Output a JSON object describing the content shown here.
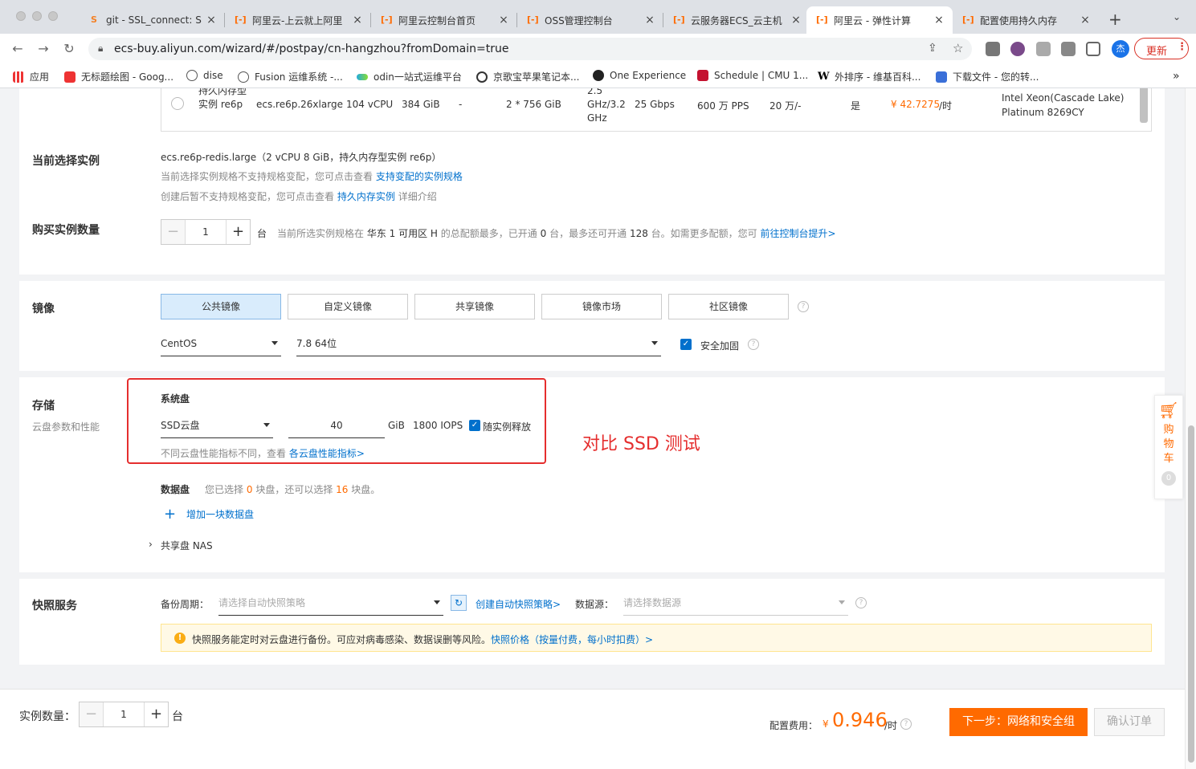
{
  "browser": {
    "tabs": [
      {
        "icon": "stackoverflow-icon",
        "title": "git - SSL_connect: S"
      },
      {
        "icon": "aliyun-icon",
        "title": "阿里云-上云就上阿里"
      },
      {
        "icon": "aliyun-icon",
        "title": "阿里云控制台首页"
      },
      {
        "icon": "aliyun-icon",
        "title": "OSS管理控制台"
      },
      {
        "icon": "aliyun-icon",
        "title": "云服务器ECS_云主机"
      },
      {
        "icon": "aliyun-icon",
        "title": "阿里云 - 弹性计算"
      },
      {
        "icon": "aliyun-icon",
        "title": "配置使用持久内存"
      }
    ],
    "active_tab": 5,
    "url": "ecs-buy.aliyun.com/wizard/#/postpay/cn-hangzhou?fromDomain=true",
    "update_label": "更新",
    "profile_initial": "杰",
    "bookmarks": [
      "应用",
      "无标题绘图 - Goog...",
      "dise",
      "Fusion 运维系统 -...",
      "odin一站式运维平台",
      "京歌宝苹果笔记本...",
      "One Experience",
      "Schedule | CMU 1...",
      "外排序 - 维基百科...",
      "下载文件 - 您的转..."
    ],
    "bookmarks_more": "»"
  },
  "instance_table_row": {
    "family": "持久内存型实例 re6p",
    "spec": "ecs.re6p.26xlarge",
    "vcpu": "104 vCPU",
    "memory": "384 GiB",
    "gpu": "-",
    "pmem": "2 * 756 GiB",
    "clock": "2.5 GHz/3.2 GHz",
    "bandwidth": "25 Gbps",
    "pps": "600 万 PPS",
    "conn": "20 万/-",
    "ipv6": "是",
    "price": "¥ 42.7275",
    "price_unit": "/时",
    "cpu_model": "Intel Xeon(Cascade Lake) Platinum 8269CY"
  },
  "current_instance": {
    "label": "当前选择实例",
    "spec": "ecs.re6p-redis.large",
    "desc": "（2 vCPU 8 GiB，持久内存型实例 re6p）",
    "line2": "当前选择实例规格不支持规格变配，您可点击查看",
    "line2_link": "支持变配的实例规格",
    "line3": "创建后暂不支持规格变配，您可点击查看",
    "line3_link": "持久内存实例",
    "line3_suffix": "详细介绍"
  },
  "quantity": {
    "label": "购买实例数量",
    "value": "1",
    "unit": "台",
    "note_prefix": "当前所选实例规格在",
    "zone": "华东 1 可用区 H",
    "note_mid": "的总配额最多，已开通",
    "opened": "0",
    "note_mid2": "台，最多还可开通",
    "remaining": "128",
    "note_suffix": "台。如需更多配额，您可",
    "link": "前往控制台提升>"
  },
  "image": {
    "label": "镜像",
    "tabs": [
      "公共镜像",
      "自定义镜像",
      "共享镜像",
      "镜像市场",
      "社区镜像"
    ],
    "selected": 0,
    "os": "CentOS",
    "version": "7.8 64位",
    "harden_label": "安全加固"
  },
  "storage": {
    "label": "存储",
    "sublabel": "云盘参数和性能",
    "sys_disk_label": "系统盘",
    "disk_type": "SSD云盘",
    "size": "40",
    "unit": "GiB",
    "iops": "1800 IOPS",
    "release_label": "随实例释放",
    "perf_note": "不同云盘性能指标不同，查看",
    "perf_link": "各云盘性能指标>",
    "data_disk_label": "数据盘",
    "data_note_prefix": "您已选择",
    "data_selected": "0",
    "data_note_mid": "块盘，还可以选择",
    "data_remaining": "16",
    "data_note_suffix": "块盘。",
    "add_data_disk": "增加一块数据盘",
    "nas_label": "共享盘 NAS",
    "annotation": "对比 SSD 测试"
  },
  "snapshot": {
    "label": "快照服务",
    "period_label": "备份周期：",
    "period_placeholder": "请选择自动快照策略",
    "create_link": "创建自动快照策略>",
    "source_label": "数据源：",
    "source_placeholder": "请选择数据源",
    "info": "快照服务能定时对云盘进行备份。可应对病毒感染、数据误删等风险。",
    "info_link": "快照价格（按量付费，每小时扣费）>"
  },
  "footer": {
    "qty_label": "实例数量：",
    "qty_value": "1",
    "qty_unit": "台",
    "cost_label": "配置费用：",
    "currency": "¥",
    "price": "0.946",
    "price_unit": "/时",
    "next_button": "下一步：网络和安全组",
    "confirm_button": "确认订单"
  },
  "cart": {
    "label": "购物车",
    "count": "0"
  }
}
